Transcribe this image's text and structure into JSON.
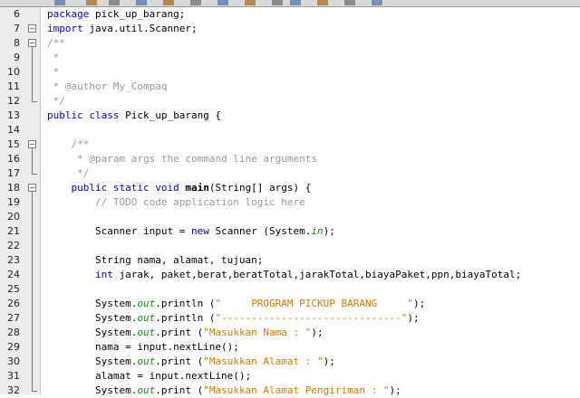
{
  "editor": {
    "lines": [
      {
        "n": "6",
        "segments": [
          {
            "t": "package ",
            "c": "kw"
          },
          {
            "t": "pick_up_barang;"
          }
        ]
      },
      {
        "n": "7",
        "fold": "-",
        "segments": [
          {
            "t": "import ",
            "c": "kw"
          },
          {
            "t": "java.util.Scanner;"
          }
        ]
      },
      {
        "n": "8",
        "fold": "-",
        "segments": [
          {
            "t": "/**",
            "c": "cm"
          }
        ]
      },
      {
        "n": "9",
        "segments": [
          {
            "t": " *",
            "c": "cm"
          }
        ]
      },
      {
        "n": "10",
        "segments": [
          {
            "t": " *",
            "c": "cm"
          }
        ]
      },
      {
        "n": "11",
        "segments": [
          {
            "t": " * @author My_Compaq",
            "c": "cm"
          }
        ]
      },
      {
        "n": "12",
        "segments": [
          {
            "t": " */",
            "c": "cm"
          }
        ]
      },
      {
        "n": "13",
        "segments": [
          {
            "t": "public class ",
            "c": "kw"
          },
          {
            "t": "Pick_up_barang {"
          }
        ]
      },
      {
        "n": "14",
        "segments": []
      },
      {
        "n": "15",
        "fold": "-",
        "segments": [
          {
            "t": "    /**",
            "c": "cm"
          }
        ]
      },
      {
        "n": "16",
        "segments": [
          {
            "t": "     * @param ",
            "c": "cm"
          },
          {
            "t": "args",
            "c": "cm"
          },
          {
            "t": " the command line arguments",
            "c": "cm"
          }
        ]
      },
      {
        "n": "17",
        "segments": [
          {
            "t": "     */",
            "c": "cm"
          }
        ]
      },
      {
        "n": "18",
        "fold": "-",
        "segments": [
          {
            "t": "    public static void ",
            "c": "kw"
          },
          {
            "t": "main",
            "c": "bold"
          },
          {
            "t": "(String[] args) {"
          }
        ]
      },
      {
        "n": "19",
        "segments": [
          {
            "t": "        // TODO code application logic here",
            "c": "cm"
          }
        ]
      },
      {
        "n": "20",
        "segments": []
      },
      {
        "n": "21",
        "segments": [
          {
            "t": "        Scanner input = "
          },
          {
            "t": "new ",
            "c": "kw"
          },
          {
            "t": "Scanner (System."
          },
          {
            "t": "in",
            "c": "fld"
          },
          {
            "t": ");"
          }
        ]
      },
      {
        "n": "22",
        "segments": []
      },
      {
        "n": "23",
        "segments": [
          {
            "t": "        String nama, alamat, tujuan;"
          }
        ]
      },
      {
        "n": "24",
        "segments": [
          {
            "t": "        int ",
            "c": "kw"
          },
          {
            "t": "jarak, paket,berat,beratTotal,jarakTotal,biayaPaket,ppn,biayaTotal;"
          }
        ]
      },
      {
        "n": "25",
        "segments": []
      },
      {
        "n": "26",
        "segments": [
          {
            "t": "        System."
          },
          {
            "t": "out",
            "c": "fld"
          },
          {
            "t": ".println ("
          },
          {
            "t": "\"     PROGRAM PICKUP BARANG     \"",
            "c": "st"
          },
          {
            "t": ");"
          }
        ]
      },
      {
        "n": "27",
        "segments": [
          {
            "t": "        System."
          },
          {
            "t": "out",
            "c": "fld"
          },
          {
            "t": ".println ("
          },
          {
            "t": "\"------------------------------\"",
            "c": "st"
          },
          {
            "t": ");"
          }
        ]
      },
      {
        "n": "28",
        "segments": [
          {
            "t": "        System."
          },
          {
            "t": "out",
            "c": "fld"
          },
          {
            "t": ".print ("
          },
          {
            "t": "\"Masukkan Nama : \"",
            "c": "st"
          },
          {
            "t": ");"
          }
        ]
      },
      {
        "n": "29",
        "segments": [
          {
            "t": "        nama = input.nextLine();"
          }
        ]
      },
      {
        "n": "30",
        "segments": [
          {
            "t": "        System."
          },
          {
            "t": "out",
            "c": "fld"
          },
          {
            "t": ".print ("
          },
          {
            "t": "\"Masukkan Alamat : \"",
            "c": "st"
          },
          {
            "t": ");"
          }
        ]
      },
      {
        "n": "31",
        "segments": [
          {
            "t": "        alamat = input.nextLine();"
          }
        ]
      },
      {
        "n": "32",
        "segments": [
          {
            "t": "        System."
          },
          {
            "t": "out",
            "c": "fld"
          },
          {
            "t": ".print ("
          },
          {
            "t": "\"Masukkan Alamat Pengiriman : \"",
            "c": "st"
          },
          {
            "t": ");"
          }
        ]
      }
    ]
  },
  "colors": {
    "keyword": "#0000e6",
    "comment": "#969696",
    "string": "#ce7b00",
    "field": "#009900"
  },
  "toolbar_icons": [
    "undo-icon",
    "redo-icon",
    "new-file-icon",
    "open-project-icon",
    "save-icon",
    "cut-icon",
    "copy-icon",
    "paste-icon",
    "run-icon",
    "debug-icon",
    "profile-icon",
    "stop-icon",
    "settings-icon"
  ]
}
